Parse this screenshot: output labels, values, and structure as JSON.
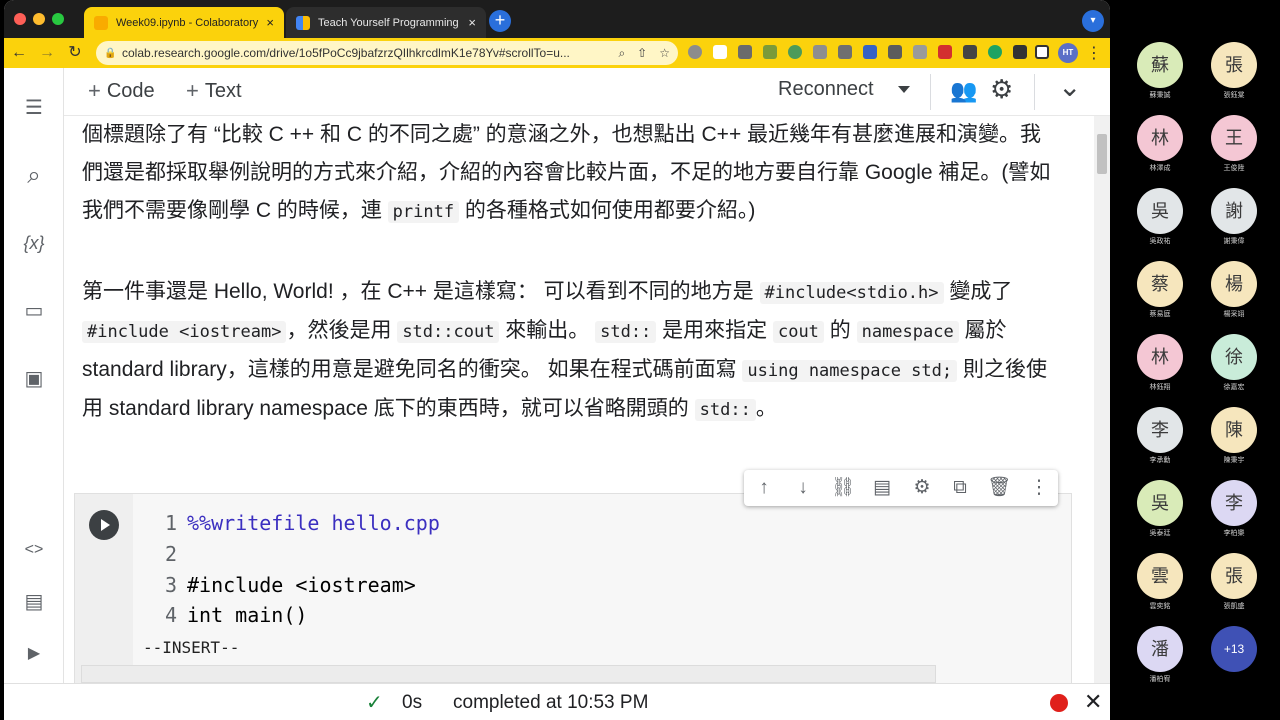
{
  "browser": {
    "tabs": [
      {
        "title": "Week09.ipynb - Colaboratory",
        "close": "×",
        "active": true
      },
      {
        "title": "Teach Yourself Programming in",
        "close": "×",
        "active": false
      }
    ],
    "new_tab": "+",
    "url": "colab.research.google.com/drive/1o5fPoCc9jbafzrzQIlhkrcdlmK1e78Yv#scrollTo=u...",
    "profile_initials": "HT",
    "icons": {
      "back": "←",
      "forward": "→",
      "reload": "↻",
      "lock": "🔒",
      "zoom": "⌕",
      "share": "⇧",
      "star": "☆",
      "menu": "⋮",
      "tab_menu": "▾"
    },
    "colors": {
      "toolbar": "#fbd20c",
      "accent": "#2a6fdb"
    }
  },
  "colab": {
    "toolbar": {
      "code_label": "Code",
      "text_label": "Text",
      "reconnect_label": "Reconnect",
      "plus": "+"
    },
    "icons": {
      "toc": "☰",
      "search": "⌕",
      "variables": "{x}",
      "files": "▭",
      "calendar": "▣",
      "snippets": "<>",
      "palette": "▤",
      "terminal": "▶",
      "people": "👥",
      "gear": "⚙",
      "collapse": "⌄"
    },
    "paragraph1": "個標題除了有 “比較 C ++ 和 C 的不同之處” 的意涵之外，也想點出 C++ 最近幾年有甚麼進展和演變。我們還是都採取舉例說明的方式來介紹，介紹的內容會比較片面，不足的地方要自行靠 Google 補足。(譬如我們不需要像剛學 C 的時候，連 ",
    "paragraph1_code": "printf",
    "paragraph1_tail": " 的各種格式如何使用都要介紹。)",
    "paragraph2": {
      "t1": "第一件事還是 Hello, World! ，在 C++ 是這樣寫： 可以看到不同的地方是 ",
      "c1": "#include<stdio.h>",
      "t2": " 變成了 ",
      "c2": "#include <iostream>",
      "t3": "，然後是用 ",
      "c3": "std::cout",
      "t4": " 來輸出。 ",
      "c4": "std::",
      "t5": " 是用來指定 ",
      "c5": "cout",
      "t6": " 的 ",
      "c6": "namespace",
      "t7": " 屬於 standard library，這樣的用意是避免同名的衝突。 如果在程式碼前面寫 ",
      "c7": "using namespace std;",
      "t8": " 則之後使用 standard library namespace 底下的東西時，就可以省略開頭的 ",
      "c8": "std::",
      "t9": "。"
    },
    "cell_tools": [
      "arrow-up",
      "arrow-down",
      "link",
      "comment",
      "settings",
      "mirror",
      "delete",
      "more"
    ],
    "cell_tool_glyphs": [
      "↑",
      "↓",
      "⛓",
      "▤",
      "⚙",
      "⧉",
      "🗑",
      "⋮"
    ],
    "code": [
      {
        "n": "1",
        "text": "%%writefile hello.cpp"
      },
      {
        "n": "2",
        "text": ""
      },
      {
        "n": "3",
        "text": "#include <iostream>"
      },
      {
        "n": "4",
        "text": "int main()"
      }
    ],
    "vim_mode": "--INSERT--",
    "status": {
      "check": "✓",
      "elapsed": "0s",
      "message": "completed at 10:53 PM",
      "close": "✕"
    }
  },
  "participants": [
    {
      "char": "蘇",
      "name": "蘇秉誠",
      "color": "#d9ebb8"
    },
    {
      "char": "張",
      "name": "張鈺棠",
      "color": "#f6e6bd"
    },
    {
      "char": "林",
      "name": "林澤成",
      "color": "#f4c7d4"
    },
    {
      "char": "王",
      "name": "王俊陞",
      "color": "#f4c7d4"
    },
    {
      "char": "吳",
      "name": "吳政祐",
      "color": "#e2e6e8"
    },
    {
      "char": "謝",
      "name": "謝秉偉",
      "color": "#e2e6e8"
    },
    {
      "char": "蔡",
      "name": "蔡易庭",
      "color": "#f6e6bd"
    },
    {
      "char": "楊",
      "name": "楊采翊",
      "color": "#f6e6bd"
    },
    {
      "char": "林",
      "name": "林鈺翔",
      "color": "#f4c7d4"
    },
    {
      "char": "徐",
      "name": "徐嘉宏",
      "color": "#c9ecd9"
    },
    {
      "char": "李",
      "name": "李承勳",
      "color": "#e2e6e8"
    },
    {
      "char": "陳",
      "name": "陳秉宇",
      "color": "#f6e6bd"
    },
    {
      "char": "吳",
      "name": "吳泰廷",
      "color": "#d9ebb8"
    },
    {
      "char": "李",
      "name": "李柏樂",
      "color": "#dcd8f3"
    },
    {
      "char": "雲",
      "name": "雲奕銘",
      "color": "#f6e6bd"
    },
    {
      "char": "張",
      "name": "張凱盛",
      "color": "#f6e6bd"
    },
    {
      "char": "潘",
      "name": "潘柏宥",
      "color": "#dcd8f3"
    },
    {
      "char": "+13",
      "name": "",
      "color": "#3f51b5"
    }
  ]
}
